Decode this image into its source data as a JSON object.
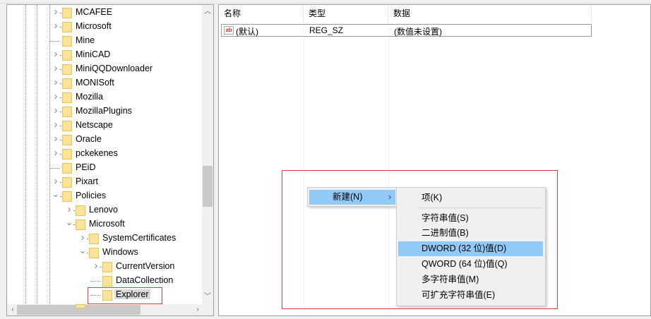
{
  "tree": {
    "items": [
      {
        "label": "MCAFEE",
        "level": 0,
        "chevron": "right"
      },
      {
        "label": "Microsoft",
        "level": 0,
        "chevron": "right"
      },
      {
        "label": "Mine",
        "level": 0,
        "chevron": "none"
      },
      {
        "label": "MiniCAD",
        "level": 0,
        "chevron": "right"
      },
      {
        "label": "MiniQQDownloader",
        "level": 0,
        "chevron": "right"
      },
      {
        "label": "MONISoft",
        "level": 0,
        "chevron": "right"
      },
      {
        "label": "Mozilla",
        "level": 0,
        "chevron": "right"
      },
      {
        "label": "MozillaPlugins",
        "level": 0,
        "chevron": "right"
      },
      {
        "label": "Netscape",
        "level": 0,
        "chevron": "right"
      },
      {
        "label": "Oracle",
        "level": 0,
        "chevron": "right"
      },
      {
        "label": "pckekenes",
        "level": 0,
        "chevron": "right"
      },
      {
        "label": "PEiD",
        "level": 0,
        "chevron": "none"
      },
      {
        "label": "Pixart",
        "level": 0,
        "chevron": "right"
      },
      {
        "label": "Policies",
        "level": 0,
        "chevron": "down"
      },
      {
        "label": "Lenovo",
        "level": 1,
        "chevron": "right"
      },
      {
        "label": "Microsoft",
        "level": 1,
        "chevron": "down"
      },
      {
        "label": "SystemCertificates",
        "level": 2,
        "chevron": "right"
      },
      {
        "label": "Windows",
        "level": 2,
        "chevron": "down"
      },
      {
        "label": "CurrentVersion",
        "level": 3,
        "chevron": "right"
      },
      {
        "label": "DataCollection",
        "level": 3,
        "chevron": "none"
      },
      {
        "label": "Explorer",
        "level": 3,
        "chevron": "none",
        "selected": true
      }
    ]
  },
  "values": {
    "columns": [
      "名称",
      "类型",
      "数据"
    ],
    "rows": [
      {
        "name": "(默认)",
        "type": "REG_SZ",
        "data": "(数值未设置)",
        "icon": "ab"
      }
    ]
  },
  "context_menu": {
    "new_label": "新建(N)",
    "arrow": "›",
    "submenu": [
      "项(K)",
      "字符串值(S)",
      "二进制值(B)",
      "DWORD (32 位)值(D)",
      "QWORD (64 位)值(Q)",
      "多字符串值(M)",
      "可扩充字符串值(E)"
    ],
    "highlighted": "DWORD (32 位)值(D)"
  },
  "colors": {
    "highlight": "#91c9f7",
    "annotation": "#e63b3b",
    "folder": "#fbe39a"
  }
}
